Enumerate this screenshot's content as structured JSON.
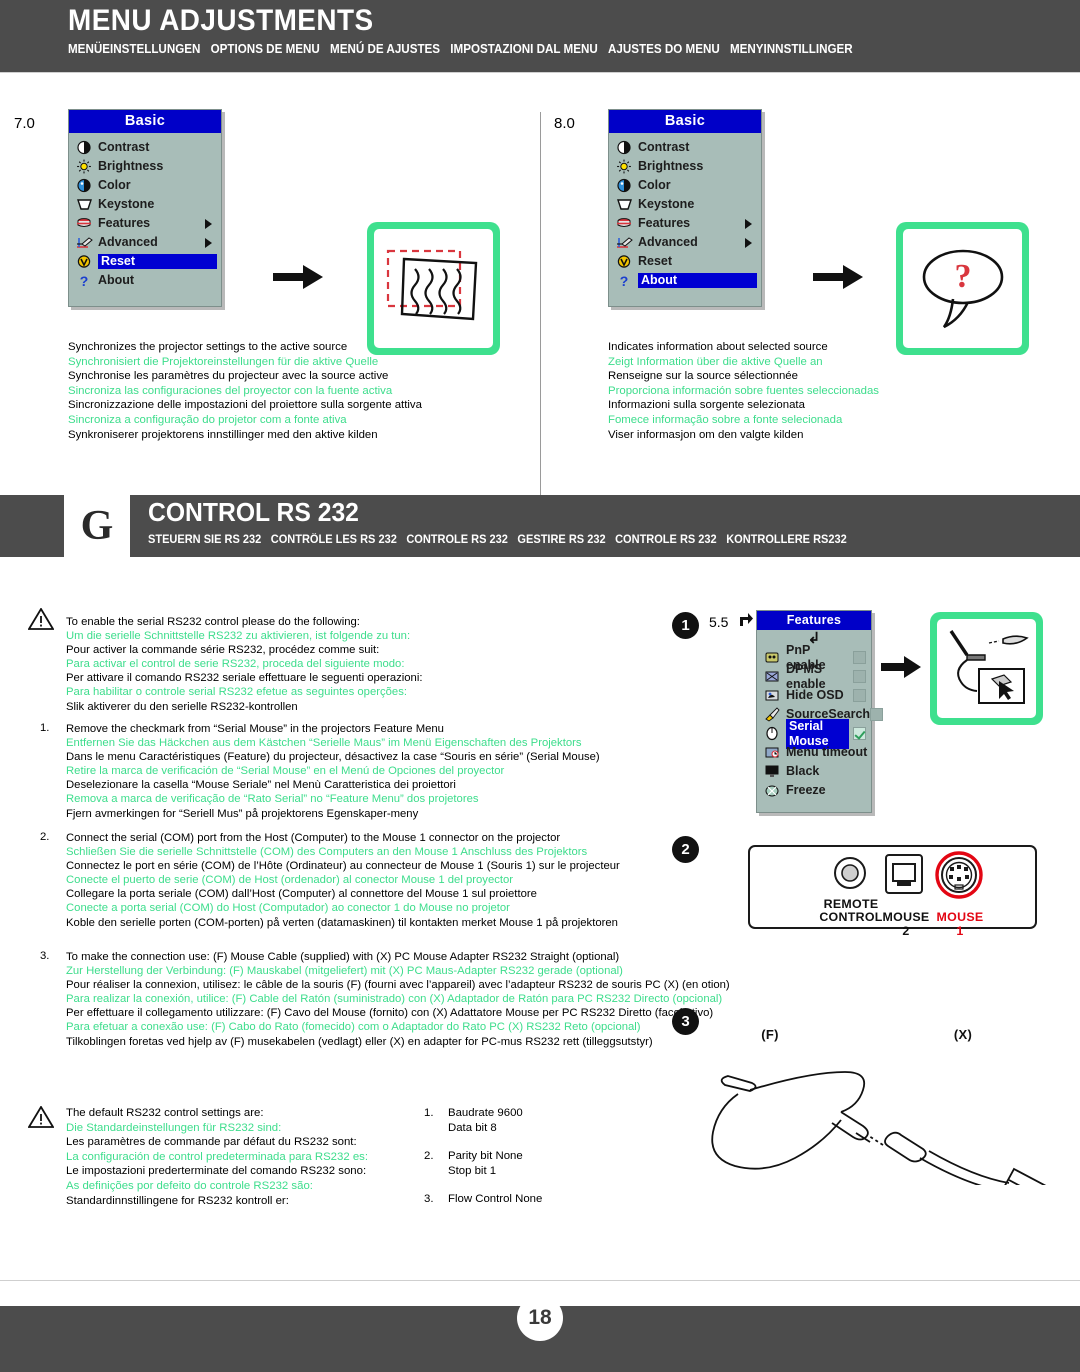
{
  "header": {
    "title": "MENU ADJUSTMENTS",
    "subtitles": [
      "MENÜEINSTELLUNGEN",
      "OPTIONS DE MENU",
      "MENÚ DE AJUSTES",
      "IMPOSTAZIONI DAL MENU",
      "AJUSTES DO MENU",
      "MENYINNSTILLINGER"
    ]
  },
  "comparison": {
    "left": {
      "step_number": "7.0",
      "menu": {
        "title": "Basic",
        "items": [
          {
            "label": "Contrast",
            "icon": "contrast-icon",
            "arrow": false,
            "selected": false
          },
          {
            "label": "Brightness",
            "icon": "brightness-icon",
            "arrow": false,
            "selected": false
          },
          {
            "label": "Color",
            "icon": "color-icon",
            "arrow": false,
            "selected": false
          },
          {
            "label": "Keystone",
            "icon": "keystone-icon",
            "arrow": false,
            "selected": false
          },
          {
            "label": "Features",
            "icon": "features-icon",
            "arrow": true,
            "selected": false
          },
          {
            "label": "Advanced",
            "icon": "advanced-icon",
            "arrow": true,
            "selected": false
          },
          {
            "label": "Reset",
            "icon": "reset-icon",
            "arrow": false,
            "selected": true
          },
          {
            "label": "About",
            "icon": "about-icon",
            "arrow": false,
            "selected": false
          }
        ]
      },
      "illustration": "keystone-distortion-icon",
      "captions": [
        {
          "text": "Synchronizes the projector settings to the active source",
          "lang": "en",
          "green": false
        },
        {
          "text": "Synchronisiert die Projektoreinstellungen für die aktive Quelle",
          "lang": "de",
          "green": true
        },
        {
          "text": "Synchronise les paramètres du projecteur avec la source active",
          "lang": "fr",
          "green": false
        },
        {
          "text": "Sincroniza las configuraciones del proyector con la fuente activa",
          "lang": "es",
          "green": true
        },
        {
          "text": "Sincronizzazione delle impostazioni del proiettore sulla sorgente attiva",
          "lang": "it",
          "green": false
        },
        {
          "text": "Sincroniza a configuração do projetor com a fonte ativa",
          "lang": "pt",
          "green": true
        },
        {
          "text": "Synkroniserer projektorens innstillinger med den aktive kilden",
          "lang": "no",
          "green": false
        }
      ]
    },
    "right": {
      "step_number": "8.0",
      "menu": {
        "title": "Basic",
        "items": [
          {
            "label": "Contrast",
            "icon": "contrast-icon",
            "arrow": false,
            "selected": false
          },
          {
            "label": "Brightness",
            "icon": "brightness-icon",
            "arrow": false,
            "selected": false
          },
          {
            "label": "Color",
            "icon": "color-icon",
            "arrow": false,
            "selected": false
          },
          {
            "label": "Keystone",
            "icon": "keystone-icon",
            "arrow": false,
            "selected": false
          },
          {
            "label": "Features",
            "icon": "features-icon",
            "arrow": true,
            "selected": false
          },
          {
            "label": "Advanced",
            "icon": "advanced-icon",
            "arrow": true,
            "selected": false
          },
          {
            "label": "Reset",
            "icon": "reset-icon",
            "arrow": false,
            "selected": false
          },
          {
            "label": "About",
            "icon": "about-icon",
            "arrow": false,
            "selected": true
          }
        ]
      },
      "illustration": "speech-bubble-question-icon",
      "captions": [
        {
          "text": "Indicates information about selected source",
          "lang": "en",
          "green": false
        },
        {
          "text": "Zeigt Information über die aktive Quelle an",
          "lang": "de",
          "green": true
        },
        {
          "text": "Renseigne sur la source sélectionnée",
          "lang": "fr",
          "green": false
        },
        {
          "text": "Proporciona información sobre fuentes seleccionadas",
          "lang": "es",
          "green": true
        },
        {
          "text": "Informazioni sulla sorgente selezionata",
          "lang": "it",
          "green": false
        },
        {
          "text": "Fomece informação sobre a fonte selecionada",
          "lang": "pt",
          "green": true
        },
        {
          "text": "Viser informasjon om den valgte kilden",
          "lang": "no",
          "green": false
        }
      ]
    }
  },
  "section": {
    "letter": "G",
    "title": "CONTROL RS 232",
    "subtitles": [
      "STEUERN SIE RS 232",
      "CONTRÔLE LES RS 232",
      "CONTROLE RS 232",
      "GESTIRE RS 232",
      "CONTROLE RS 232",
      "KONTROLLERE RS232"
    ]
  },
  "intro": {
    "lines": [
      {
        "text": "To enable the serial RS232 control please do the following:",
        "green": false
      },
      {
        "text": "Um die serielle Schnittstelle RS232 zu aktivieren, ist folgende zu tun:",
        "green": true
      },
      {
        "text": "Pour activer la commande série RS232, procédez comme suit:",
        "green": false
      },
      {
        "text": "Para activar el control de serie RS232, proceda del siguiente modo:",
        "green": true
      },
      {
        "text": "Per attivare il comando RS232 seriale effettuare le seguenti operazioni:",
        "green": false
      },
      {
        "text": "Para habilitar o controle serial RS232 efetue as seguintes operções:",
        "green": true
      },
      {
        "text": "Slik aktiverer du den serielle RS232-kontrollen",
        "green": false
      }
    ]
  },
  "steps": [
    {
      "number": "1.",
      "badge": "1",
      "badge_label": "5.5",
      "lines": [
        {
          "text": "Remove the checkmark from “Serial Mouse” in the projectors Feature Menu",
          "green": false
        },
        {
          "text": "Entfernen Sie das Häckchen aus dem Kästchen “Serielle Maus” im Menü Eigenschaften des Projektors",
          "green": true
        },
        {
          "text": "Dans le menu Caractéristiques (Feature) du projecteur, désactivez la case “Souris en série” (Serial Mouse)",
          "green": false
        },
        {
          "text": "Retire la marca de verificación de “Serial Mouse” en el Menú de Opciones del proyector",
          "green": true
        },
        {
          "text": "Deselezionare la casella “Mouse Seriale” nel Menù Caratteristica dei proiettori",
          "green": false
        },
        {
          "text": "Remova a marca de verificação de “Rato Serial” no “Feature Menu” dos projetores",
          "green": true
        },
        {
          "text": "Fjern avmerkingen for “Seriell Mus” på projektorens Egenskaper-meny",
          "green": false
        }
      ]
    },
    {
      "number": "2.",
      "badge": "2",
      "badge_label": "",
      "lines": [
        {
          "text": "Connect the serial (COM) port from the Host (Computer) to the Mouse 1 connector on the projector",
          "green": false
        },
        {
          "text": "Schließen Sie die serielle Schnittstelle (COM) des Computers an den Mouse 1 Anschluss des Projektors",
          "green": true
        },
        {
          "text": "Connectez le port en série (COM) de l’Hôte (Ordinateur) au connecteur de Mouse 1 (Souris 1) sur le projecteur",
          "green": false
        },
        {
          "text": "Conecte el puerto de serie (COM) de Host (ordenador) al conector Mouse 1 del proyector",
          "green": true
        },
        {
          "text": "Collegare la porta seriale (COM) dall’Host (Computer) al connettore del Mouse 1 sul proiettore",
          "green": false
        },
        {
          "text": "Conecte a porta serial (COM) do Host (Computador) ao conector 1 do Mouse no projetor",
          "green": true
        },
        {
          "text": "Koble den serielle porten (COM-porten) på verten (datamaskinen) til kontakten merket Mouse 1 på projektoren",
          "green": false
        }
      ]
    },
    {
      "number": "3.",
      "badge": "3",
      "badge_label": "",
      "lines": [
        {
          "text": "To make the connection use: (F) Mouse Cable (supplied) with (X) PC Mouse Adapter RS232 Straight (optional)",
          "green": false
        },
        {
          "text": "Zur Herstellung der Verbindung: (F) Mauskabel (mitgeliefert) mit (X) PC Maus-Adapter RS232 gerade (optional)",
          "green": true
        },
        {
          "text": "Pour réaliser la connexion, utilisez: le câble de la souris (F) (fourni avec l’appareil) avec l’adapteur RS232 de souris  PC (X) (en otion)",
          "green": false
        },
        {
          "text": "Para realizar la conexión, utilice: (F) Cable del Ratón (suministrado) con (X) Adaptador de Ratón para PC RS232 Directo (opcional)",
          "green": true
        },
        {
          "text": "Per effettuare il collegamento utilizzare: (F) Cavo del Mouse (fornito) con (X) Adattatore Mouse per PC RS232 Diretto (facoltativo)",
          "green": false
        },
        {
          "text": "Para efetuar a conexão use: (F) Cabo do Rato (fomecido) com o Adaptador do Rato PC (X) RS232 Reto (opcional)",
          "green": true
        },
        {
          "text": "Tilkoblingen foretas ved hjelp av (F) musekabelen (vedlagt) eller (X) en adapter for PC-mus RS232 rett (tilleggsutstyr)",
          "green": false
        }
      ]
    }
  ],
  "features_menu": {
    "title": "Features",
    "items": [
      {
        "label": "PnP enable",
        "icon": "pnp-icon",
        "checkbox": true,
        "checked": false,
        "selected": false
      },
      {
        "label": "DPMS enable",
        "icon": "dpms-icon",
        "checkbox": true,
        "checked": false,
        "selected": false
      },
      {
        "label": "Hide OSD",
        "icon": "hide-osd-icon",
        "checkbox": true,
        "checked": false,
        "selected": false
      },
      {
        "label": "SourceSearch",
        "icon": "source-search-icon",
        "checkbox": true,
        "checked": false,
        "selected": false
      },
      {
        "label": "Serial Mouse",
        "icon": "mouse-icon",
        "checkbox": true,
        "checked": true,
        "selected": true
      },
      {
        "label": "Menu timeout",
        "icon": "menu-timeout-icon",
        "checkbox": false,
        "checked": false,
        "selected": false
      },
      {
        "label": "Black",
        "icon": "black-screen-icon",
        "checkbox": false,
        "checked": false,
        "selected": false
      },
      {
        "label": "Freeze",
        "icon": "freeze-icon",
        "checkbox": false,
        "checked": false,
        "selected": false
      }
    ]
  },
  "connector_panel": {
    "ports": [
      {
        "label_line1": "REMOTE",
        "label_line2": "CONTROL",
        "type": "jack-port",
        "highlight": false
      },
      {
        "label_line1": "MOUSE 2",
        "label_line2": "",
        "type": "usb-port",
        "highlight": false
      },
      {
        "label_line1": "MOUSE 1",
        "label_line2": "",
        "type": "mini-din-port",
        "highlight": true
      }
    ],
    "highlight_color": "#e30613"
  },
  "cable_diagram": {
    "label_f": "(F)",
    "label_x": "(X)"
  },
  "defaults": {
    "lines": [
      {
        "text": "The default RS232 control settings are:",
        "green": false
      },
      {
        "text": "Die Standardeinstellungen für RS232 sind:",
        "green": true
      },
      {
        "text": "Les paramètres de commande par défaut du RS232 sont:",
        "green": false
      },
      {
        "text": "La configuración de control predeterminada para RS232 es:",
        "green": true
      },
      {
        "text": "Le impostazioni prederterminate del comando RS232 sono:",
        "green": false
      },
      {
        "text": "As definições por defeito do controle RS232 são:",
        "green": true
      },
      {
        "text": "Standardinnstillingene for RS232 kontroll er:",
        "green": false
      }
    ],
    "settings": [
      {
        "number": "1.",
        "line1": "Baudrate 9600",
        "line2": "Data bit 8"
      },
      {
        "number": "2.",
        "line1": "Parity bit None",
        "line2": "Stop bit 1"
      },
      {
        "number": "3.",
        "line1": "Flow Control None",
        "line2": ""
      }
    ]
  },
  "footer": {
    "page_number": "18"
  },
  "colors": {
    "band": "#4c4c4c",
    "green_text": "#3ddd8c",
    "osd_title_bg": "#0000c8",
    "osd_body_bg": "#a8bdb8",
    "highlight_red": "#e30613",
    "illustration_green": "#3ee08e"
  }
}
